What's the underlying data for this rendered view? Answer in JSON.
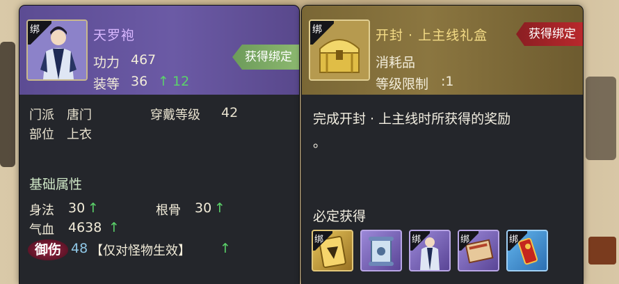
{
  "left_item": {
    "bind_tag": "绑",
    "name": "天罗袍",
    "power_label": "功力",
    "power_value": "467",
    "level_label": "装等",
    "level_value": "36",
    "level_up_arrow": "↑",
    "level_up_value": "12",
    "acquire_tag": "获得绑定",
    "sect_label": "门派",
    "sect_value": "唐门",
    "slot_label": "部位",
    "slot_value": "上衣",
    "wear_level_label": "穿戴等级",
    "wear_level_value": "42",
    "base_attr_title": "基础属性",
    "attrs": [
      {
        "label": "身法",
        "value": "30",
        "arrow": "↑"
      },
      {
        "label": "根骨",
        "value": "30",
        "arrow": "↑"
      },
      {
        "label": "气血",
        "value": "4638",
        "arrow": "↑"
      }
    ],
    "special_badge": "御伤",
    "special_value": "48",
    "special_note": "【仅对怪物生效】",
    "special_arrow": "↑"
  },
  "right_item": {
    "bind_tag": "绑",
    "name": "开封 · 上主线礼盒",
    "acquire_tag": "获得绑定",
    "type": "消耗品",
    "level_limit_label": "等级限制",
    "level_limit_value": ":1",
    "description_line1": "完成开封 · 上主线时所获得的奖励",
    "description_line2": "。",
    "guaranteed_title": "必定获得",
    "rewards": [
      {
        "bind": "绑",
        "icon": "golden-card-icon"
      },
      {
        "bind": "",
        "icon": "scroll-icon"
      },
      {
        "bind": "绑",
        "icon": "robe-icon"
      },
      {
        "bind": "绑",
        "icon": "book-icon"
      },
      {
        "bind": "绑",
        "icon": "red-token-icon"
      }
    ]
  },
  "colors": {
    "purple_header": "#6b5aa5",
    "gold_header": "#8b7640",
    "panel_bg": "#24262b",
    "positive": "#5bd36a",
    "warning": "#ff3a36"
  }
}
